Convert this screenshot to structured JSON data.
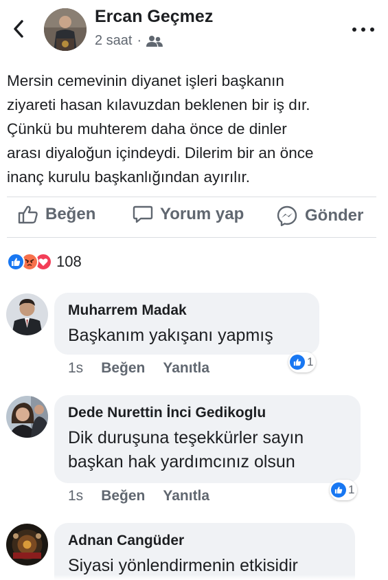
{
  "post": {
    "author": "Ercan Geçmez",
    "time": "2 saat",
    "separator": "·",
    "privacy_icon": "friends-icon",
    "text": "Mersin cemevinin diyanet işleri başkanın\nziyareti hasan kılavuzdan beklenen  bir iş dır.\nÇünkü bu muhterem daha önce de dinler\narası diyaloğun içindeydi. Dilerim bir an önce\ninanç kurulu başkanlığından ayırılır."
  },
  "actions": {
    "like_label": "Beğen",
    "comment_label": "Yorum yap",
    "send_label": "Gönder"
  },
  "reactions": {
    "types": [
      "like",
      "angry",
      "love"
    ],
    "count": "108"
  },
  "comments": [
    {
      "name": "Muharrem Madak",
      "text": "Başkanım yakışanı yapmış",
      "time": "1s",
      "like_label": "Beğen",
      "reply_label": "Yanıtla",
      "like_count": "1"
    },
    {
      "name": "Dede Nurettin İnci Gedikoglu",
      "text": "Dik duruşuna teşekkürler sayın\nbaşkan hak yardımcınız olsun",
      "time": "1s",
      "like_label": "Beğen",
      "reply_label": "Yanıtla",
      "like_count": "1"
    },
    {
      "name": "Adnan Cangüder",
      "text": "Siyasi yönlendirmenin etkisidir"
    }
  ],
  "colors": {
    "text": "#1c1e21",
    "secondary": "#606770",
    "bubble": "#f0f2f5",
    "like_blue": "#1877f2",
    "angry_orange": "#f7714c",
    "love_red": "#f33e58"
  }
}
